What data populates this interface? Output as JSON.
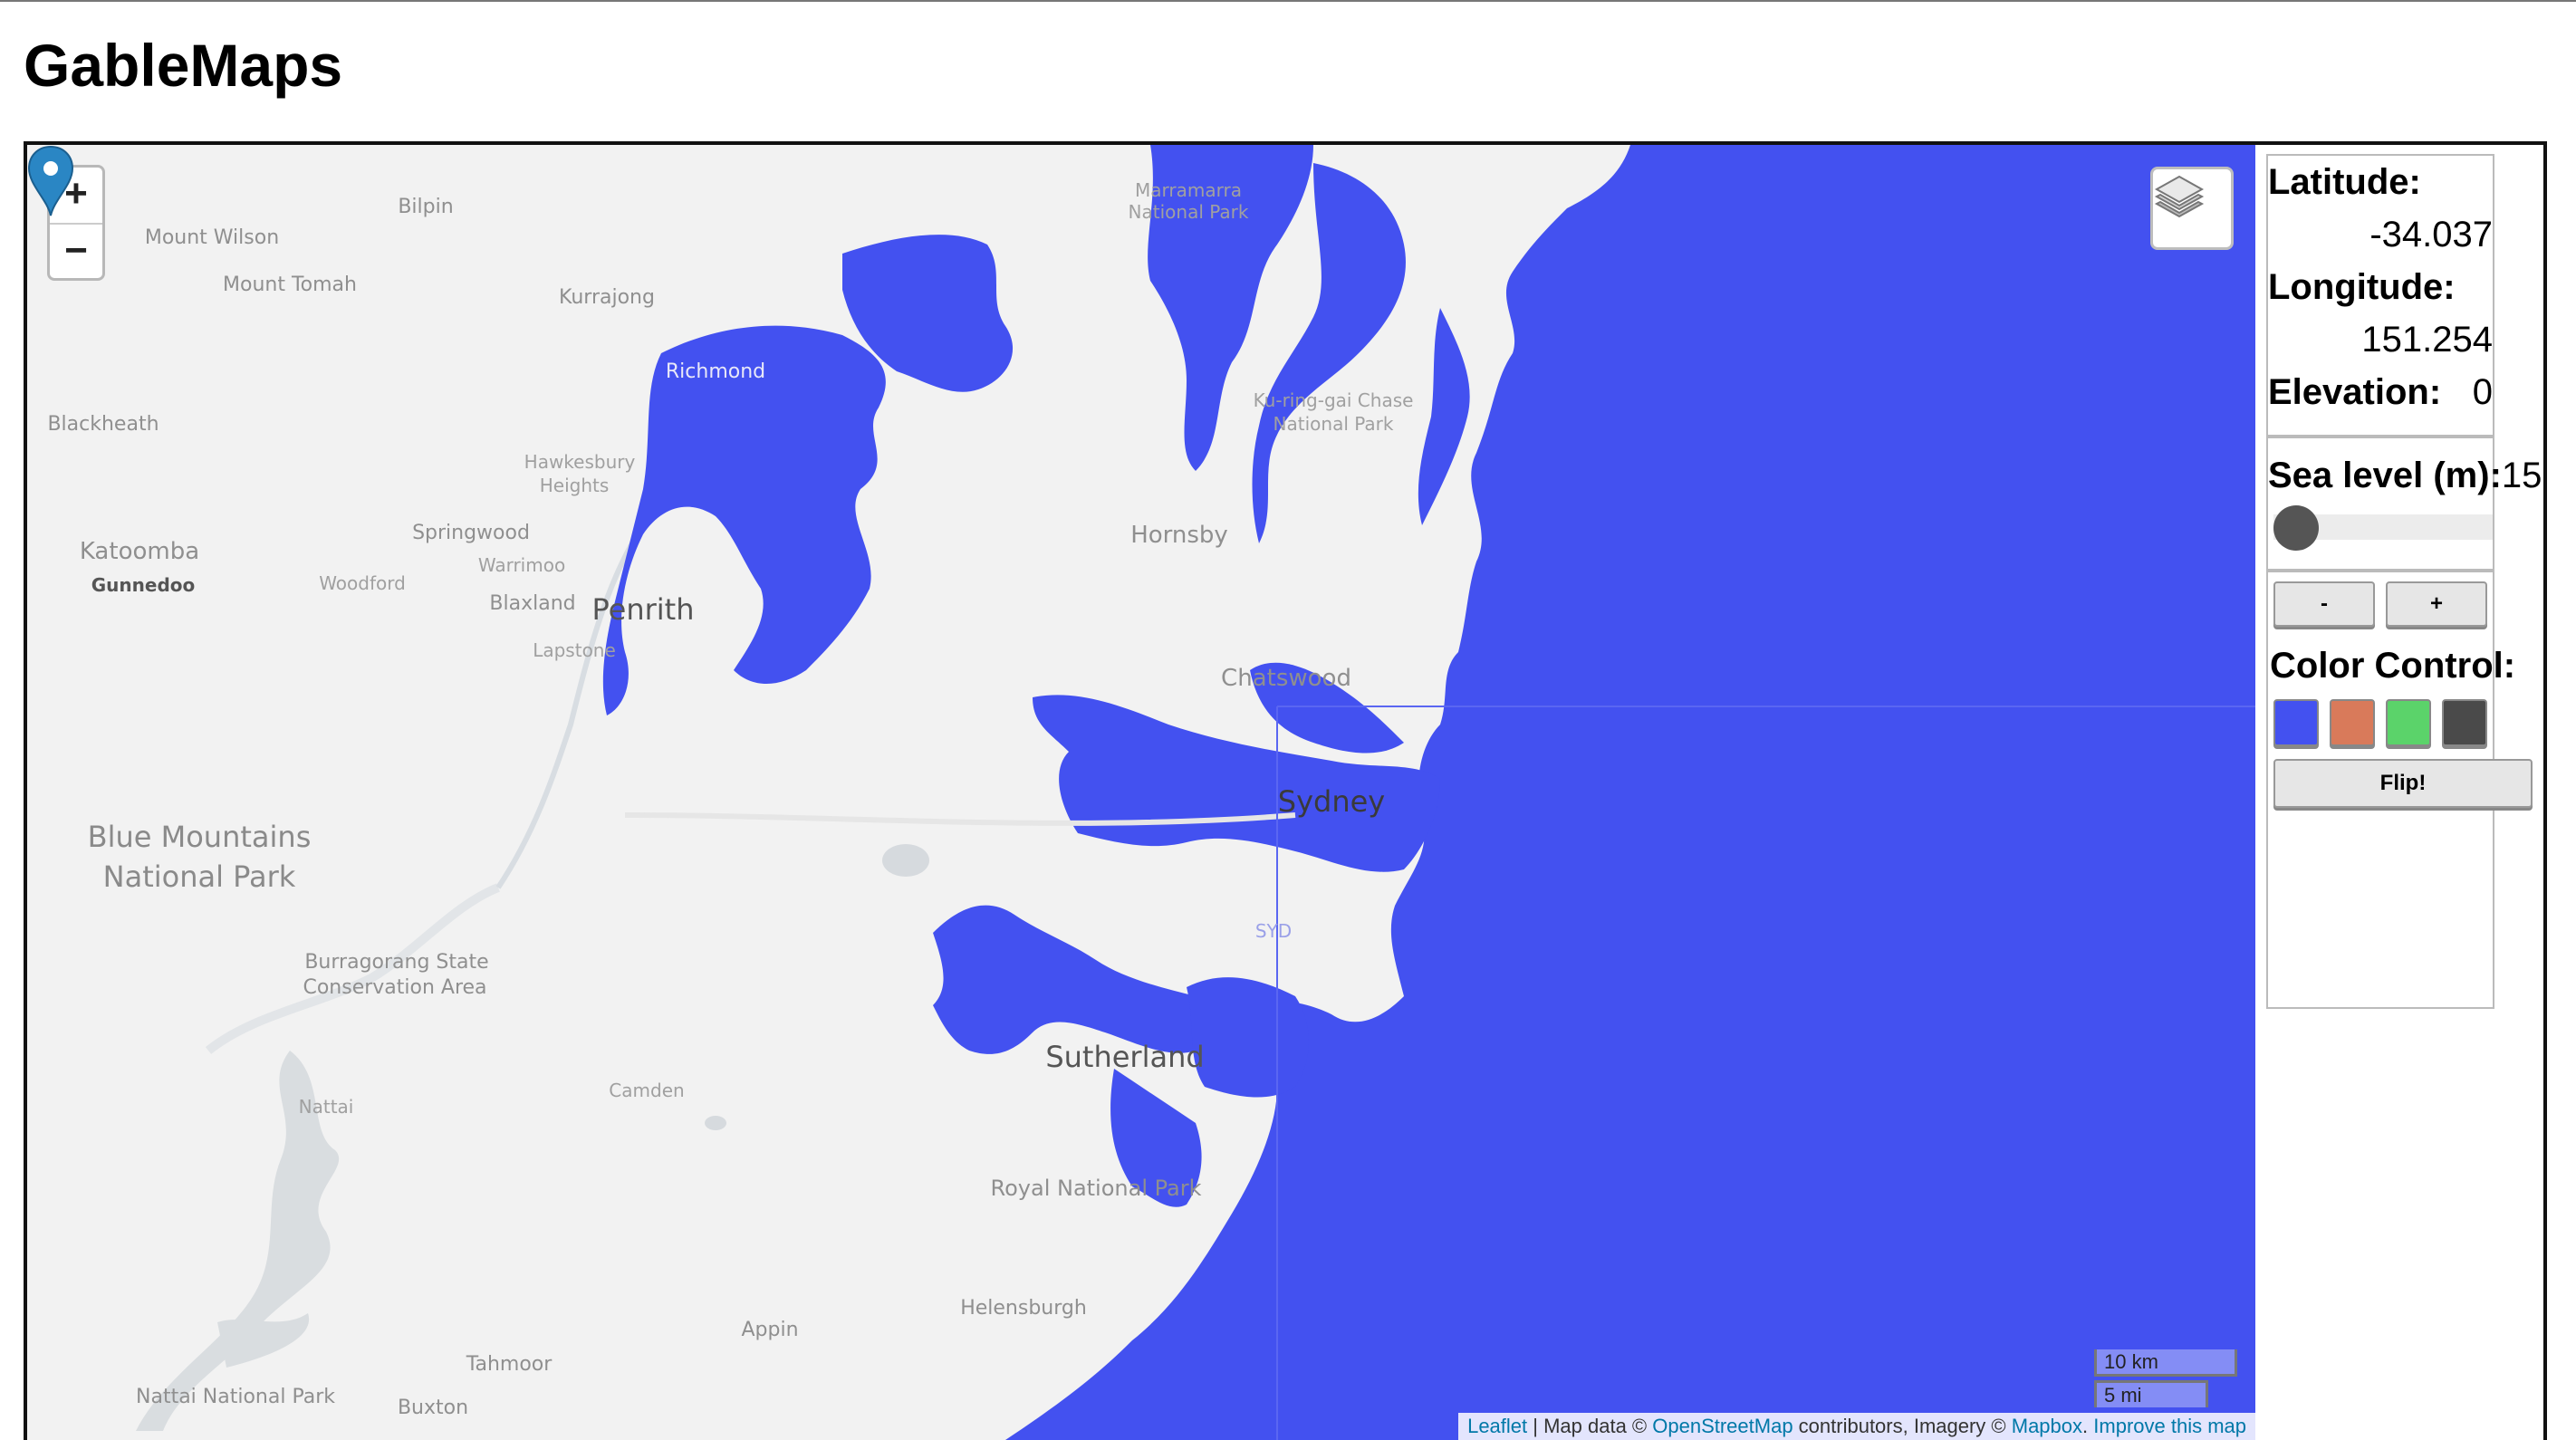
{
  "app": {
    "title": "GableMaps"
  },
  "colors": {
    "water": "#4351f0",
    "land": "#f2f2f2",
    "pin": "#2a86c4"
  },
  "map": {
    "zoom_in": "+",
    "zoom_out": "−",
    "layers_icon": "layers-icon",
    "marker_icon": "map-marker-icon",
    "places": [
      {
        "name": "Bilpin"
      },
      {
        "name": "Mount Wilson"
      },
      {
        "name": "Mount Tomah"
      },
      {
        "name": "Kurrajong"
      },
      {
        "name": "Blackheath"
      },
      {
        "name": "Richmond"
      },
      {
        "name": "Hawkesbury"
      },
      {
        "name": "Heights"
      },
      {
        "name": "Springwood"
      },
      {
        "name": "Warrimoo"
      },
      {
        "name": "Katoomba"
      },
      {
        "name": "Gunnedoo"
      },
      {
        "name": "Woodford"
      },
      {
        "name": "Blaxland"
      },
      {
        "name": "Penrith"
      },
      {
        "name": "Lapstone"
      },
      {
        "name": "Hornsby"
      },
      {
        "name": "Chatswood"
      },
      {
        "name": "Sydney"
      },
      {
        "name": "SYD"
      },
      {
        "name": "Sutherland"
      },
      {
        "name": "Camden"
      },
      {
        "name": "Nattai"
      },
      {
        "name": "Royal National Park"
      },
      {
        "name": "Appin"
      },
      {
        "name": "Helensburgh"
      },
      {
        "name": "Tahmoor"
      },
      {
        "name": "Buxton"
      },
      {
        "name": "Nattai National Park"
      },
      {
        "name": "Marramarra"
      },
      {
        "name": "National Park"
      },
      {
        "name": "Ku-ring-gai Chase"
      },
      {
        "name": "National Park"
      },
      {
        "name": "Blue Mountains"
      },
      {
        "name": "National Park"
      },
      {
        "name": "Burragorang State"
      },
      {
        "name": "Conservation Area"
      }
    ],
    "scale": {
      "km": "10 km",
      "mi": "5 mi"
    },
    "attribution": {
      "leaflet": "Leaflet",
      "map_data": " | Map data © ",
      "osm": "OpenStreetMap",
      "contrib": " contributors, Imagery © ",
      "mapbox": "Mapbox",
      "dot": ". ",
      "improve": "Improve this map"
    }
  },
  "panel": {
    "latitude_label": "Latitude:",
    "latitude_value": "-34.037",
    "longitude_label": "Longitude:",
    "longitude_value": "151.254",
    "elevation_label": "Elevation:",
    "elevation_value": "0",
    "sea_level_label": "Sea level (m):",
    "sea_level_value": "15",
    "sea_level_fraction": 0.0,
    "minus_label": "-",
    "plus_label": "+",
    "color_control_label": "Color Control:",
    "swatches": [
      "#4351f0",
      "#d97a5a",
      "#5bd36a",
      "#4a4a4a"
    ],
    "flip_label": "Flip!"
  }
}
